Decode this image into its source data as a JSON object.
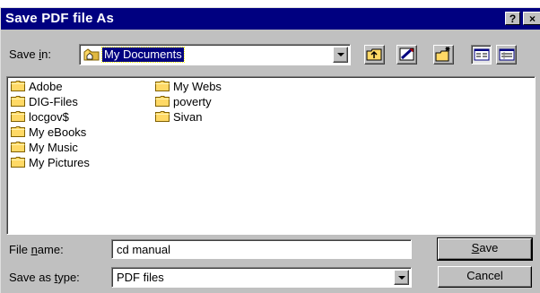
{
  "window": {
    "title": "Save PDF file As",
    "help_label": "?",
    "close_label": "×"
  },
  "save_in": {
    "label_pre": "Save ",
    "label_accel": "i",
    "label_post": "n:",
    "selected": "My Documents",
    "icon": "home-folder-icon"
  },
  "toolbar": {
    "up_icon": "up-one-level-icon",
    "desktop_icon": "desktop-icon",
    "new_folder_icon": "new-folder-icon",
    "list_icon": "list-view-icon",
    "details_icon": "details-view-icon"
  },
  "files": {
    "column1": [
      "Adobe",
      "DIG-Files",
      "locgov$",
      "My eBooks",
      "My Music",
      "My Pictures"
    ],
    "column2": [
      "My Webs",
      "poverty",
      "Sivan"
    ]
  },
  "filename": {
    "label_pre": "File ",
    "label_accel": "n",
    "label_post": "ame:",
    "value": "cd manual"
  },
  "filetype": {
    "label_pre": "Save as ",
    "label_accel": "t",
    "label_post": "ype:",
    "value": "PDF files"
  },
  "buttons": {
    "save_accel": "S",
    "save_rest": "ave",
    "cancel": "Cancel"
  },
  "colors": {
    "title_bar": "#000080",
    "face": "#c0c0c0",
    "folder": "#ffd966"
  }
}
